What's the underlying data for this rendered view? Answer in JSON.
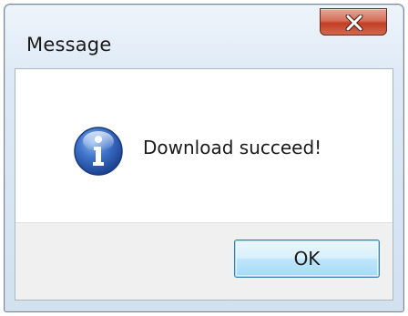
{
  "window": {
    "title": "Message"
  },
  "titlebar": {
    "close_icon": "close-x-icon",
    "close_color": "#c13e24"
  },
  "message": {
    "icon": "info-icon",
    "icon_color": "#2f61b5",
    "text": "Download succeed!"
  },
  "buttons": {
    "ok_label": "OK",
    "ok_accent": "#3c7fb1"
  }
}
